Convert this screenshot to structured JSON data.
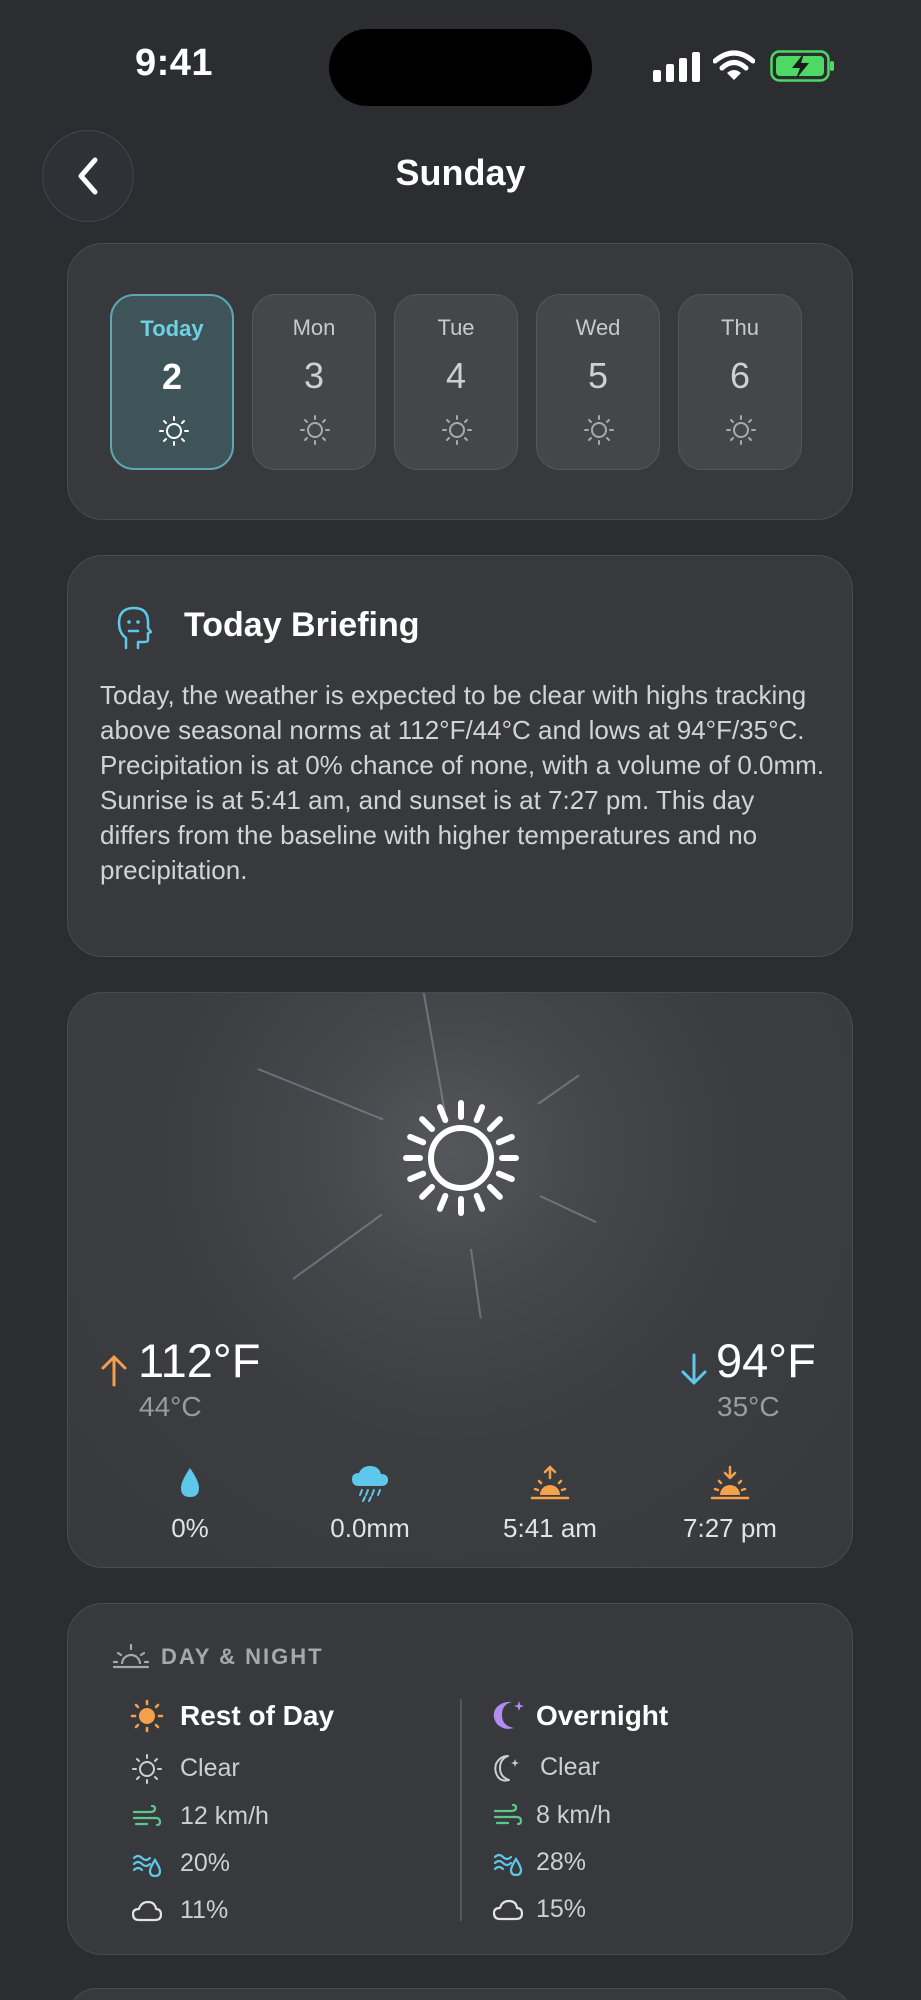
{
  "status_bar": {
    "time": "9:41"
  },
  "header": {
    "title": "Sunday"
  },
  "days": [
    {
      "name": "Today",
      "num": "2",
      "icon": "sun-icon",
      "active": true
    },
    {
      "name": "Mon",
      "num": "3",
      "icon": "sun-icon",
      "active": false
    },
    {
      "name": "Tue",
      "num": "4",
      "icon": "sun-icon",
      "active": false
    },
    {
      "name": "Wed",
      "num": "5",
      "icon": "sun-icon",
      "active": false
    },
    {
      "name": "Thu",
      "num": "6",
      "icon": "sun-icon",
      "active": false
    }
  ],
  "briefing": {
    "title": "Today Briefing",
    "text": "Today, the weather is expected to be clear with highs tracking above seasonal norms at 112°F/44°C and lows at 94°F/35°C. Precipitation is at 0% chance of none, with a volume of 0.0mm. Sunrise is at 5:41 am, and sunset is at 7:27 pm. This day differs from the baseline with higher temperatures and no precipitation."
  },
  "weather": {
    "high_f": "112°F",
    "high_c": "44°C",
    "low_f": "94°F",
    "low_c": "35°C",
    "stats": [
      {
        "icon": "droplet-icon",
        "value": "0%"
      },
      {
        "icon": "rain-cloud-icon",
        "value": "0.0mm"
      },
      {
        "icon": "sunrise-icon",
        "value": "5:41 am"
      },
      {
        "icon": "sunset-icon",
        "value": "7:27 pm"
      }
    ]
  },
  "day_night": {
    "title": "DAY & NIGHT",
    "day": {
      "heading": "Rest of Day",
      "condition": "Clear",
      "wind": "12 km/h",
      "humidity": "20%",
      "cloud": "11%"
    },
    "night": {
      "heading": "Overnight",
      "condition": "Clear",
      "wind": "8 km/h",
      "humidity": "28%",
      "cloud": "15%"
    }
  },
  "colors": {
    "accent_teal": "#6fd0e4",
    "high_arrow": "#f5a04a",
    "low_arrow": "#5ec8ea",
    "sun_orange": "#f5a04a",
    "moon_purple": "#b48cf0",
    "wind_green": "#5cc98a",
    "humidity_blue": "#5ec8ea",
    "battery_green": "#4cd964"
  }
}
